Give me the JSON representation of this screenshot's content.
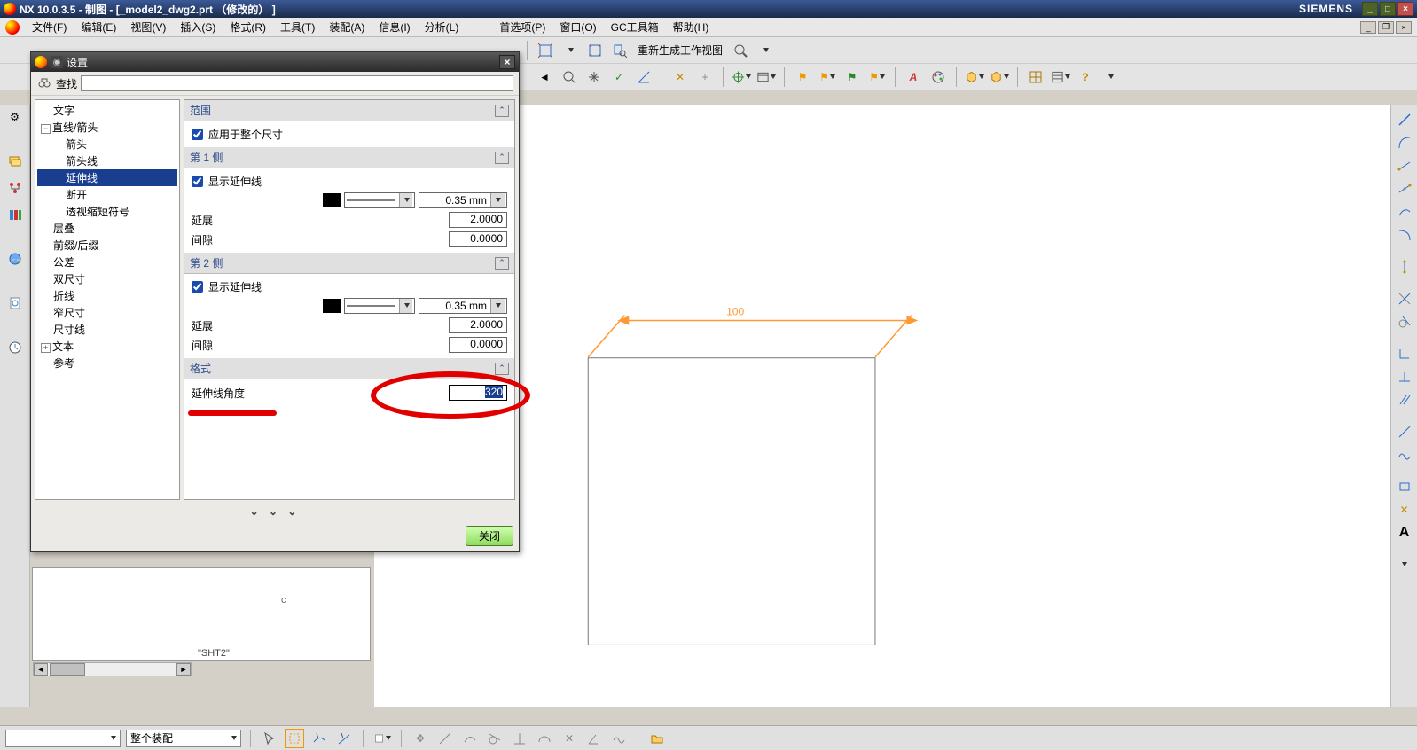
{
  "title": "NX 10.0.3.5 - 制图 - [_model2_dwg2.prt （修改的） ]",
  "brand": "SIEMENS",
  "menu": [
    "文件(F)",
    "编辑(E)",
    "视图(V)",
    "插入(S)",
    "格式(R)",
    "工具(T)",
    "装配(A)",
    "信息(I)",
    "分析(L)",
    "首选项(P)",
    "窗口(O)",
    "GC工具箱",
    "帮助(H)"
  ],
  "toolbar1": {
    "regen_label": "重新生成工作视图"
  },
  "settings": {
    "title": "设置",
    "find_label": "查找",
    "find_value": "",
    "tree": {
      "items": [
        {
          "label": "文字",
          "level": 1
        },
        {
          "label": "直线/箭头",
          "level": 1,
          "exp": "-"
        },
        {
          "label": "箭头",
          "level": 2
        },
        {
          "label": "箭头线",
          "level": 2
        },
        {
          "label": "延伸线",
          "level": 2,
          "sel": true
        },
        {
          "label": "断开",
          "level": 2
        },
        {
          "label": "透视缩短符号",
          "level": 2
        },
        {
          "label": "层叠",
          "level": 1
        },
        {
          "label": "前缀/后缀",
          "level": 1
        },
        {
          "label": "公差",
          "level": 1
        },
        {
          "label": "双尺寸",
          "level": 1
        },
        {
          "label": "折线",
          "level": 1
        },
        {
          "label": "窄尺寸",
          "level": 1
        },
        {
          "label": "尺寸线",
          "level": 1
        },
        {
          "label": "文本",
          "level": 1,
          "exp": "+"
        },
        {
          "label": "参考",
          "level": 1
        }
      ]
    },
    "sections": {
      "range": {
        "header": "范围",
        "apply_whole": "应用于整个尺寸",
        "apply_whole_checked": true
      },
      "side1": {
        "header": "第 1 侧",
        "show_ext": "显示延伸线",
        "show_ext_checked": true,
        "thickness": "0.35 mm",
        "extend_label": "延展",
        "extend_value": "2.0000",
        "gap_label": "间隙",
        "gap_value": "0.0000"
      },
      "side2": {
        "header": "第 2 侧",
        "show_ext": "显示延伸线",
        "show_ext_checked": true,
        "thickness": "0.35 mm",
        "extend_label": "延展",
        "extend_value": "2.0000",
        "gap_label": "间隙",
        "gap_value": "0.0000"
      },
      "format": {
        "header": "格式",
        "angle_label": "延伸线角度",
        "angle_value": "320"
      }
    },
    "close_btn": "关闭"
  },
  "sheet_tab": "\"SHT2\"",
  "status": {
    "combo1": "",
    "combo2": "整个装配"
  },
  "drawing": {
    "dim_value": "100"
  }
}
